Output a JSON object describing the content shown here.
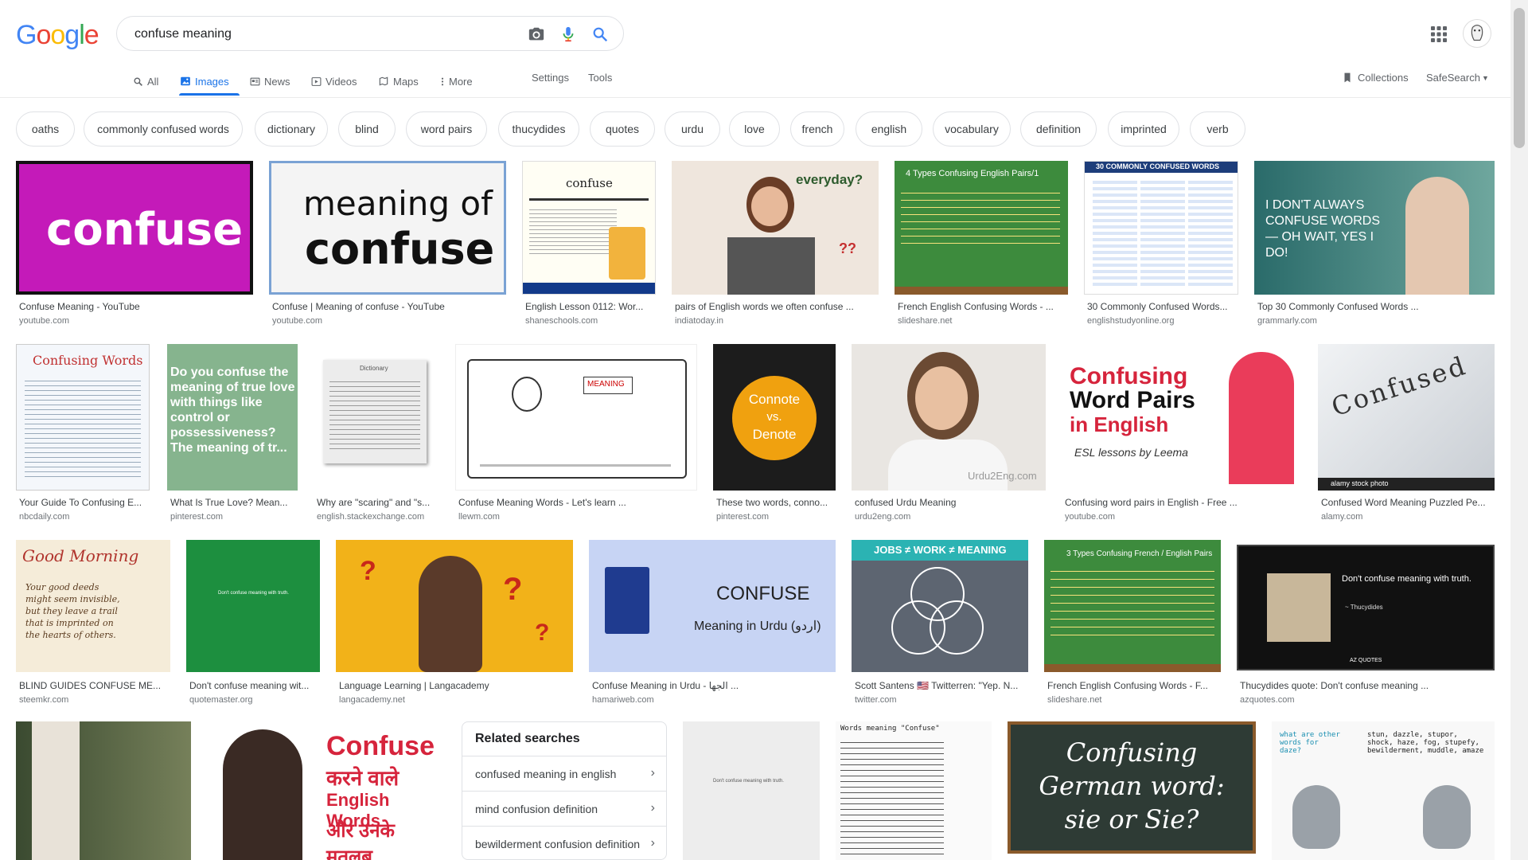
{
  "logo": {
    "g1": "G",
    "o1": "o",
    "o2": "o",
    "g2": "g",
    "l": "l",
    "e": "e"
  },
  "search": {
    "query": "confuse meaning"
  },
  "tabs": {
    "all": "All",
    "images": "Images",
    "news": "News",
    "videos": "Videos",
    "maps": "Maps",
    "more": "More",
    "settings": "Settings",
    "tools": "Tools"
  },
  "right_tools": {
    "collections": "Collections",
    "safesearch": "SafeSearch"
  },
  "chips": [
    "oaths",
    "commonly confused words",
    "dictionary",
    "blind",
    "word pairs",
    "thucydides",
    "quotes",
    "urdu",
    "love",
    "french",
    "english",
    "vocabulary",
    "definition",
    "imprinted",
    "verb"
  ],
  "row1": [
    {
      "title": "Confuse Meaning - YouTube",
      "source": "youtube.com",
      "thumb_text": "confuse",
      "bg": "#c41ab9"
    },
    {
      "title": "Confuse | Meaning of confuse - YouTube",
      "source": "youtube.com",
      "thumb_text1": "meaning of",
      "thumb_text2": "confuse",
      "bg": "#f4f4f4"
    },
    {
      "title": "English Lesson 0112: Wor...",
      "source": "shaneschools.com",
      "thumb_text": "confuse",
      "bg": "#fffef4"
    },
    {
      "title": "pairs of English words we often confuse ...",
      "source": "indiatoday.in",
      "thumb_text1": "everyday?",
      "thumb_text2": "??",
      "bg": "#efe6dd"
    },
    {
      "title": "French English Confusing Words - ...",
      "source": "slideshare.net",
      "thumb_text": "4 Types Confusing English Pairs/1",
      "bg": "#3d8b3d"
    },
    {
      "title": "30 Commonly Confused Words...",
      "source": "englishstudyonline.org",
      "thumb_text": "30 COMMONLY CONFUSED WORDS",
      "bg": "#1d3d7a"
    },
    {
      "title": "Top 30 Commonly Confused Words ...",
      "source": "grammarly.com",
      "thumb_text": "I DON'T ALWAYS CONFUSE WORDS — OH WAIT, YES I DO!",
      "bg": "#2a6b6a"
    }
  ],
  "row2": [
    {
      "title": "Your Guide To Confusing E...",
      "source": "nbcdaily.com",
      "thumb_text": "Confusing Words",
      "bg": "#f4f7fb"
    },
    {
      "title": "What Is True Love? Mean...",
      "source": "pinterest.com",
      "thumb_text": "Do you confuse the meaning of true love with things like control or possessiveness? The meaning of tr...",
      "bg": "#86b48e"
    },
    {
      "title": "Why are \"scaring\" and \"s...",
      "source": "english.stackexchange.com",
      "thumb_text": "Dictionary",
      "bg": "#ececec"
    },
    {
      "title": "Confuse Meaning Words - Let's learn ...",
      "source": "llewm.com",
      "thumb_text": "MEANING",
      "bg": "#ffffff"
    },
    {
      "title": "These two words, conno...",
      "source": "pinterest.com",
      "thumb_text1": "Connote",
      "thumb_text2": "vs.",
      "thumb_text3": "Denote",
      "bg": "#1c1c1c"
    },
    {
      "title": "confused Urdu Meaning",
      "source": "urdu2eng.com",
      "thumb_text": "Urdu2Eng.com",
      "bg": "#e9e6e2"
    },
    {
      "title": "Confusing word pairs in English - Free ...",
      "source": "youtube.com",
      "thumb_text1": "Confusing",
      "thumb_text2": "Word Pairs",
      "thumb_text3": "in English",
      "thumb_text4": "ESL lessons by Leema",
      "bg": "#ffffff"
    },
    {
      "title": "Confused Word Meaning Puzzled Pe...",
      "source": "alamy.com",
      "thumb_text": "Confused",
      "thumb_text2": "alamy stock photo",
      "bg": "#dfe3e7"
    }
  ],
  "row3": [
    {
      "title": "BLIND GUIDES CONFUSE ME...",
      "source": "steemkr.com",
      "thumb_text1": "Good Morning",
      "thumb_text2": "Your good deeds might seem invisible, but they leave a trail that is imprinted on the hearts of others.",
      "bg": "#f5ecd9"
    },
    {
      "title": "Don't confuse meaning wit...",
      "source": "quotemaster.org",
      "thumb_text": "Don't confuse meaning with truth.",
      "bg": "#1d8f3f"
    },
    {
      "title": "Language Learning | Langacademy",
      "source": "langacademy.net",
      "thumb_text": "?",
      "bg": "#f2b219"
    },
    {
      "title": "Confuse Meaning in Urdu - الجھا ...",
      "source": "hamariweb.com",
      "thumb_text1": "CONFUSE",
      "thumb_text2": "Meaning in Urdu (اردو)",
      "bg": "#c7d4f4"
    },
    {
      "title": "Scott Santens 🇺🇸 Twitterren: \"Yep. N...",
      "source": "twitter.com",
      "thumb_text": "JOBS ≠ WORK ≠ MEANING",
      "bg": "#5d6571"
    },
    {
      "title": "French English Confusing Words - F...",
      "source": "slideshare.net",
      "thumb_text": "3 Types Confusing French / English Pairs",
      "bg": "#3d8b3d"
    },
    {
      "title": "Thucydides quote: Don't confuse meaning ...",
      "source": "azquotes.com",
      "thumb_text1": "Don't confuse meaning with truth.",
      "thumb_text2": "~ Thucydides",
      "thumb_text3": "AZ QUOTES",
      "bg": "#111111"
    }
  ],
  "row4": [
    {
      "bg": "#4a5a3a"
    },
    {
      "thumb_text1": "Confuse",
      "thumb_text2": "करने वाले",
      "thumb_text3": "English Words",
      "thumb_text4": "और उनके मतलब",
      "bg": "#ffffff"
    },
    {
      "thumb_text": "Don't confuse meaning with truth.",
      "bg": "#ededed"
    },
    {
      "thumb_text": "Words meaning \"Confuse\"",
      "bg": "#fafafa"
    },
    {
      "thumb_text1": "Confusing",
      "thumb_text2": "German word:",
      "thumb_text3": "sie or Sie?",
      "bg": "#2e3b35"
    },
    {
      "thumb_text1": "what are other words for daze?",
      "thumb_text2": "stun, dazzle, stupor, shock, haze, fog, stupefy, bewilderment, muddle, amaze",
      "bg": "#f8f8f8"
    }
  ],
  "related": {
    "heading": "Related searches",
    "items": [
      "confused meaning in english",
      "mind confusion definition",
      "bewilderment confusion definition"
    ]
  },
  "colors": {
    "accent": "#1a73e8",
    "border": "#dfe1e5"
  }
}
